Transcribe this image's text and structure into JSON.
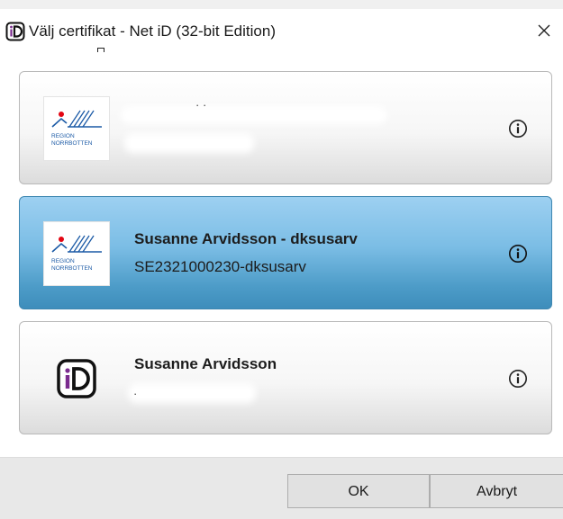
{
  "window": {
    "title": "Välj certifikat - Net iD (32-bit Edition)",
    "app_icon": "net-id-logo-icon",
    "close_icon": "close-icon"
  },
  "certificates": [
    {
      "name": "",
      "id": "",
      "logo": "region-norrbotten-logo",
      "logo_text_line1": "REGION",
      "logo_text_line2": "NORRBOTTEN",
      "selected": false,
      "info_icon": "info-icon"
    },
    {
      "name": "Susanne Arvidsson - dksusarv",
      "id": "SE2321000230-dksusarv",
      "logo": "region-norrbotten-logo",
      "logo_text_line1": "REGION",
      "logo_text_line2": "NORRBOTTEN",
      "selected": true,
      "info_icon": "info-icon"
    },
    {
      "name": "Susanne Arvidsson",
      "id": "",
      "logo": "net-id-logo",
      "selected": false,
      "info_icon": "info-icon"
    }
  ],
  "footer": {
    "ok_label": "OK",
    "cancel_label": "Avbryt"
  },
  "colors": {
    "selected_card_top": "#9dd0f1",
    "selected_card_bottom": "#3d8dbb",
    "logo_red": "#e30613",
    "logo_blue": "#1b5aa6",
    "net_id_purple": "#7b2c8f"
  }
}
